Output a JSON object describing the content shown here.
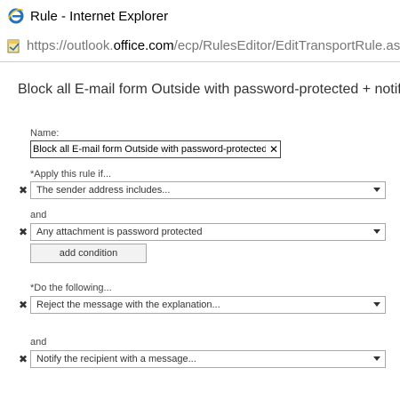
{
  "window": {
    "title": "Rule - Internet Explorer"
  },
  "address_bar": {
    "url_prefix": "https://outlook.",
    "url_host": "office.com",
    "url_path": "/ecp/RulesEditor/EditTransportRule.aspx?"
  },
  "page": {
    "title": "Block all E-mail form Outside with password-protected + notify"
  },
  "form": {
    "name_label": "Name:",
    "name_value": "Block all E-mail form Outside with password-protected + notify",
    "apply_label": "*Apply this rule if...",
    "condition_1": "The sender address includes...",
    "and_label_1": "and",
    "condition_2": "Any attachment is password protected",
    "add_condition_label": "add condition",
    "do_label": "*Do the following...",
    "action_1": "Reject the message with the explanation...",
    "and_label_2": "and",
    "action_2": "Notify the recipient with a message...",
    "remove_glyph": "✖",
    "clear_glyph": "✕"
  },
  "colors": {
    "ie_blue": "#1e73be",
    "ie_ring": "#f5b52a",
    "border": "#a8a8a8"
  }
}
